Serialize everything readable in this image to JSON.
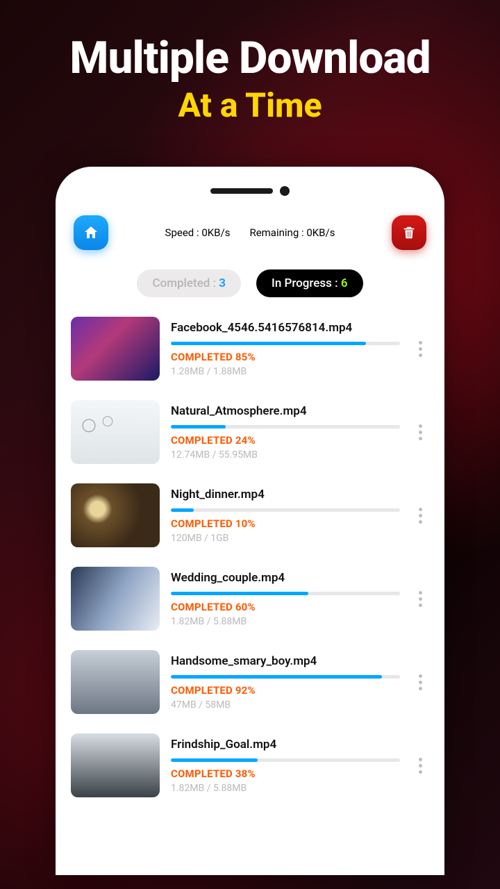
{
  "hero": {
    "line1": "Multiple Download",
    "line2": "At a Time"
  },
  "topbar": {
    "speed_label": "Speed : ",
    "speed_value": "0KB/s",
    "remaining_label": "Remaining : ",
    "remaining_value": "0KB/s"
  },
  "tabs": {
    "completed_label": "Completed : ",
    "completed_count": "3",
    "progress_label": "In Progress : ",
    "progress_count": "6"
  },
  "status_prefix": "COMPLETED ",
  "items": [
    {
      "name": "Facebook_4546.5416576814.mp4",
      "pct": 85,
      "pct_txt": "85%",
      "size": "1.28MB / 1.88MB"
    },
    {
      "name": "Natural_Atmosphere.mp4",
      "pct": 24,
      "pct_txt": "24%",
      "size": "12.74MB / 55.95MB"
    },
    {
      "name": "Night_dinner.mp4",
      "pct": 10,
      "pct_txt": "10%",
      "size": "120MB / 1GB"
    },
    {
      "name": "Wedding_couple.mp4",
      "pct": 60,
      "pct_txt": "60%",
      "size": "1.82MB / 5.88MB"
    },
    {
      "name": "Handsome_smary_boy.mp4",
      "pct": 92,
      "pct_txt": "92%",
      "size": "47MB / 58MB"
    },
    {
      "name": "Frindship_Goal.mp4",
      "pct": 38,
      "pct_txt": "38%",
      "size": "1.82MB / 5.88MB"
    }
  ]
}
